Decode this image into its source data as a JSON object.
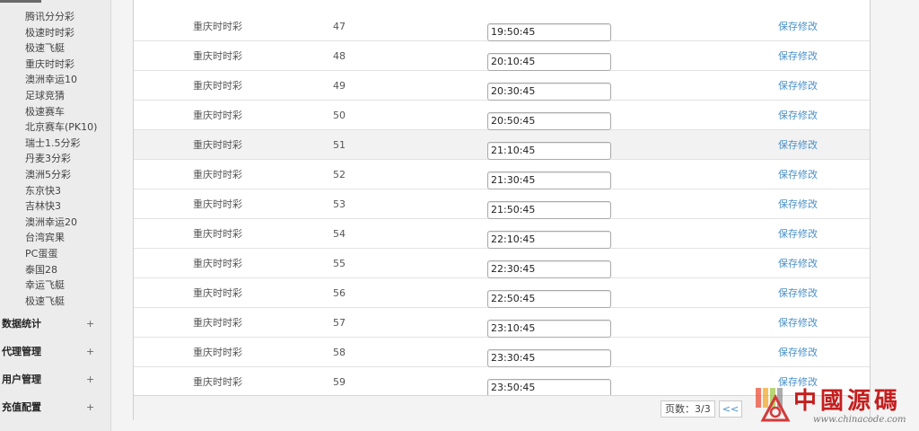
{
  "sidebar": {
    "lottery_items": [
      "腾讯分分彩",
      "极速时时彩",
      "极速飞艇",
      "重庆时时彩",
      "澳洲幸运10",
      "足球竞猜",
      "极速赛车",
      "北京赛车(PK10)",
      "瑞士1.5分彩",
      "丹麦3分彩",
      "澳洲5分彩",
      "东京快3",
      "吉林快3",
      "澳洲幸运20",
      "台湾宾果",
      "PC蛋蛋",
      "泰国28",
      "幸运飞艇",
      "极速飞艇"
    ],
    "sections": [
      {
        "label": "数据统计",
        "expand": "+"
      },
      {
        "label": "代理管理",
        "expand": "+"
      },
      {
        "label": "用户管理",
        "expand": "+"
      },
      {
        "label": "充值配置",
        "expand": "+"
      }
    ]
  },
  "table": {
    "rows": [
      {
        "type": "重庆时时彩",
        "number": "47",
        "time": "19:50:45",
        "action": "保存修改"
      },
      {
        "type": "重庆时时彩",
        "number": "48",
        "time": "20:10:45",
        "action": "保存修改"
      },
      {
        "type": "重庆时时彩",
        "number": "49",
        "time": "20:30:45",
        "action": "保存修改"
      },
      {
        "type": "重庆时时彩",
        "number": "50",
        "time": "20:50:45",
        "action": "保存修改"
      },
      {
        "type": "重庆时时彩",
        "number": "51",
        "time": "21:10:45",
        "action": "保存修改"
      },
      {
        "type": "重庆时时彩",
        "number": "52",
        "time": "21:30:45",
        "action": "保存修改"
      },
      {
        "type": "重庆时时彩",
        "number": "53",
        "time": "21:50:45",
        "action": "保存修改"
      },
      {
        "type": "重庆时时彩",
        "number": "54",
        "time": "22:10:45",
        "action": "保存修改"
      },
      {
        "type": "重庆时时彩",
        "number": "55",
        "time": "22:30:45",
        "action": "保存修改"
      },
      {
        "type": "重庆时时彩",
        "number": "56",
        "time": "22:50:45",
        "action": "保存修改"
      },
      {
        "type": "重庆时时彩",
        "number": "57",
        "time": "23:10:45",
        "action": "保存修改"
      },
      {
        "type": "重庆时时彩",
        "number": "58",
        "time": "23:30:45",
        "action": "保存修改"
      },
      {
        "type": "重庆时时彩",
        "number": "59",
        "time": "23:50:45",
        "action": "保存修改"
      }
    ],
    "highlighted_row": "51"
  },
  "pager": {
    "page_info": "页数：3/3",
    "prev_label": "<<"
  },
  "watermark": {
    "title": "中國源碼",
    "url": "www.chinacode.com",
    "bar_colors": [
      "#e9432b",
      "#f3a21c",
      "#9ac43a",
      "#8a8a8a"
    ]
  },
  "colors": {
    "link": "#4a90c8",
    "highlight_row": "#f2f2f2",
    "brand_red": "#c41e1e"
  }
}
